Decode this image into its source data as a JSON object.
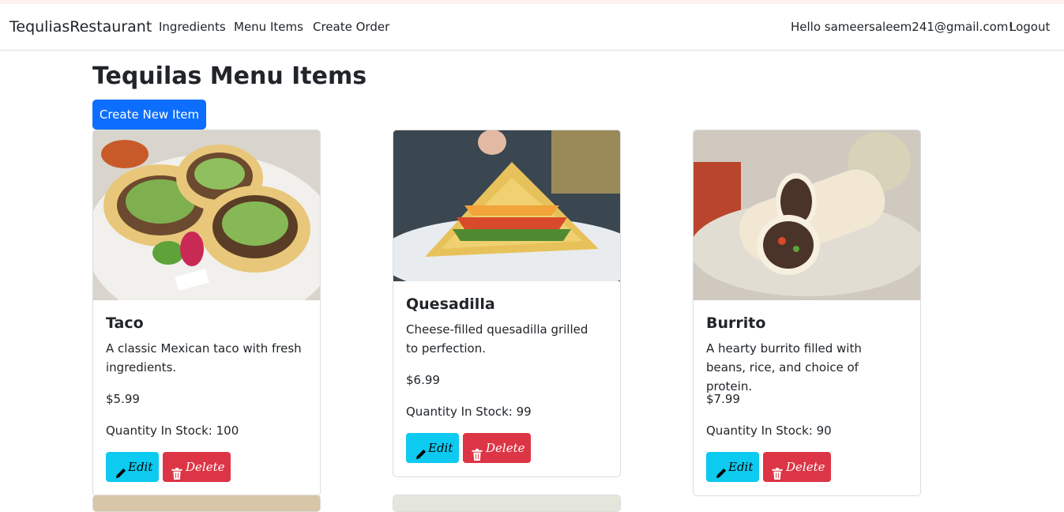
{
  "nav": {
    "brand": "TequliasRestaurant",
    "links": [
      "Ingredients",
      "Menu Items",
      "Create Order"
    ],
    "greeting": "Hello sameersaleem241@gmail.com!",
    "logout": "Logout"
  },
  "page": {
    "title": "Tequilas Menu Items",
    "create_button": "Create New Item"
  },
  "items": [
    {
      "name": "Taco",
      "description": "A classic Mexican taco with fresh ingredients.",
      "price": "$5.99",
      "stock": "Quantity In Stock: 100",
      "edit": "Edit",
      "delete": "Delete"
    },
    {
      "name": "Quesadilla",
      "description": "Cheese-filled quesadilla grilled to perfection.",
      "price": "$6.99",
      "stock": "Quantity In Stock: 99",
      "edit": "Edit",
      "delete": "Delete"
    },
    {
      "name": "Burrito",
      "description": "A hearty burrito filled with beans, rice, and choice of protein.",
      "price": "$7.99",
      "stock": "Quantity In Stock: 90",
      "edit": "Edit",
      "delete": "Delete"
    }
  ],
  "colors": {
    "primary": "#0d6efd",
    "info": "#0dcaf0",
    "danger": "#dc3545"
  },
  "icons": {
    "edit": "pencil-icon",
    "delete": "trash-icon"
  }
}
